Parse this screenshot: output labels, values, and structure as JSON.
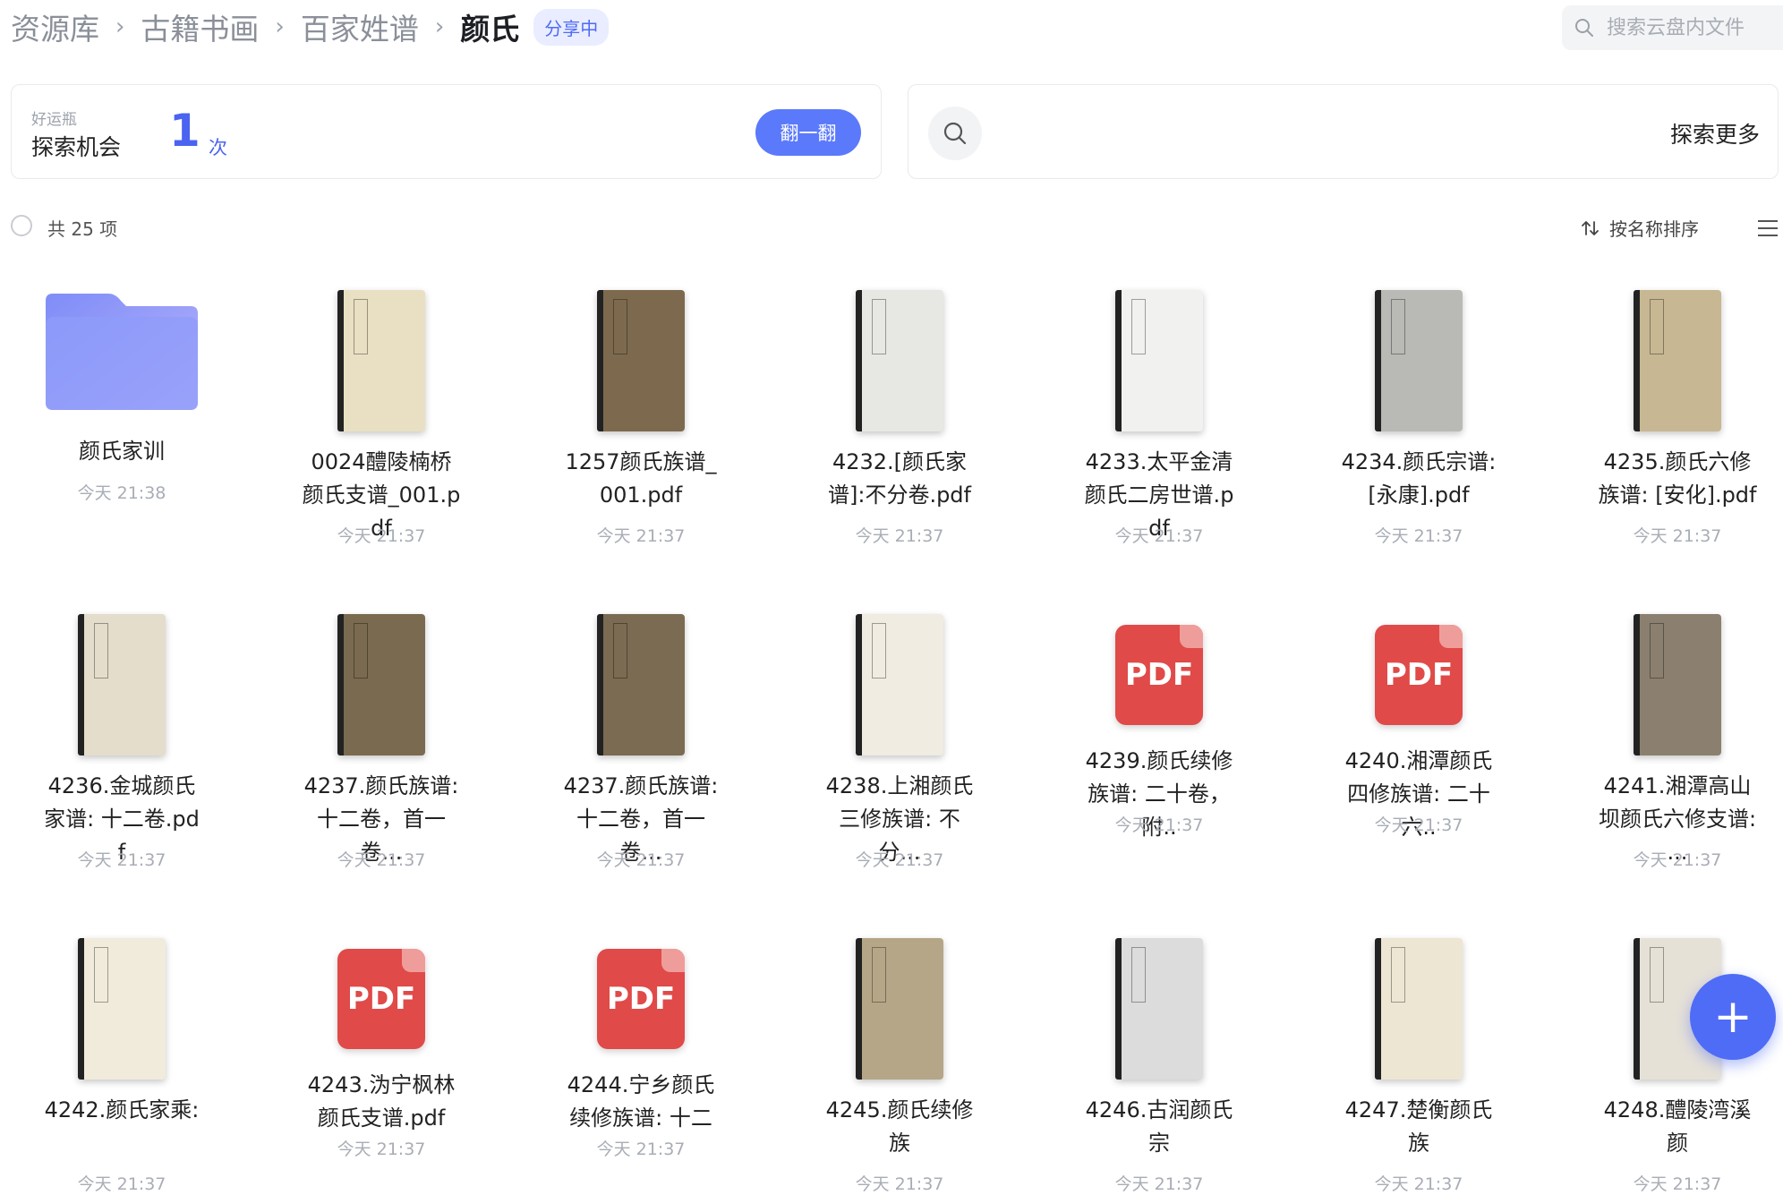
{
  "breadcrumb": {
    "items": [
      "资源库",
      "古籍书画",
      "百家姓谱"
    ],
    "current": "颜氏",
    "badge": "分享中"
  },
  "search": {
    "placeholder": "搜索云盘内文件"
  },
  "lucky_card": {
    "label": "好运瓶",
    "chance_label": "探索机会",
    "count": "1",
    "unit": "次",
    "button": "翻一翻"
  },
  "explore_card": {
    "label": "探索更多"
  },
  "toolbar": {
    "count_text": "共 25 项",
    "sort_label": "按名称排序"
  },
  "files": [
    {
      "name": "颜氏家训",
      "time": "今天 21:38",
      "kind": "folder"
    },
    {
      "name": "0024醴陵楠桥颜氏支谱_001.pdf",
      "time": "今天 21:37",
      "kind": "book",
      "color": "#e9dfc3"
    },
    {
      "name": "1257颜氏族谱_001.pdf",
      "time": "今天 21:37",
      "kind": "book",
      "color": "#7d6a4e"
    },
    {
      "name": "4232.[颜氏家谱]:不分卷.pdf",
      "time": "今天 21:37",
      "kind": "book",
      "color": "#e7e7e4"
    },
    {
      "name": "4233.太平金清颜氏二房世谱.pdf",
      "time": "今天 21:37",
      "kind": "book",
      "color": "#f1f1ef"
    },
    {
      "name": "4234.颜氏宗谱:[永康].pdf",
      "time": "今天 21:37",
      "kind": "book",
      "color": "#b9b9b5"
    },
    {
      "name": "4235.颜氏六修族谱: [安化].pdf",
      "time": "今天 21:37",
      "kind": "book",
      "color": "#c7b793"
    },
    {
      "name": "4236.金城颜氏家谱: 十二卷.pdf",
      "time": "今天 21:37",
      "kind": "book",
      "color": "#e4ddcc"
    },
    {
      "name": "4237.颜氏族谱:十二卷，首一卷...",
      "time": "今天 21:37",
      "kind": "book",
      "color": "#7a6a50"
    },
    {
      "name": "4237.颜氏族谱:十二卷，首一卷...",
      "time": "今天 21:37",
      "kind": "book",
      "color": "#7b6b52"
    },
    {
      "name": "4238.上湘颜氏三修族谱: 不分...",
      "time": "今天 21:37",
      "kind": "book",
      "color": "#f0ece2"
    },
    {
      "name": "4239.颜氏续修族谱: 二十卷，附..",
      "time": "今天 21:37",
      "kind": "pdf"
    },
    {
      "name": "4240.湘潭颜氏四修族谱: 二十六..",
      "time": "今天 21:37",
      "kind": "pdf"
    },
    {
      "name": "4241.湘潭高山坝颜氏六修支谱: ...",
      "time": "今天 21:37",
      "kind": "book",
      "color": "#8b806f"
    },
    {
      "name": "4242.颜氏家乘:",
      "time": "今天 21:37",
      "kind": "book",
      "color": "#f1ebdc"
    },
    {
      "name": "4243.沩宁枫林颜氏支谱.pdf",
      "time": "今天 21:37",
      "kind": "pdf"
    },
    {
      "name": "4244.宁乡颜氏续修族谱: 十二",
      "time": "今天 21:37",
      "kind": "pdf"
    },
    {
      "name": "4245.颜氏续修族",
      "time": "今天 21:37",
      "kind": "book",
      "color": "#b6a688"
    },
    {
      "name": "4246.古润颜氏宗",
      "time": "今天 21:37",
      "kind": "book",
      "color": "#dcdcdc"
    },
    {
      "name": "4247.楚衡颜氏族",
      "time": "今天 21:37",
      "kind": "book",
      "color": "#ede6d3"
    },
    {
      "name": "4248.醴陵湾溪颜",
      "time": "今天 21:37",
      "kind": "book",
      "color": "#e6e1d7"
    }
  ],
  "pdf_label": "PDF",
  "fab_label": "+"
}
